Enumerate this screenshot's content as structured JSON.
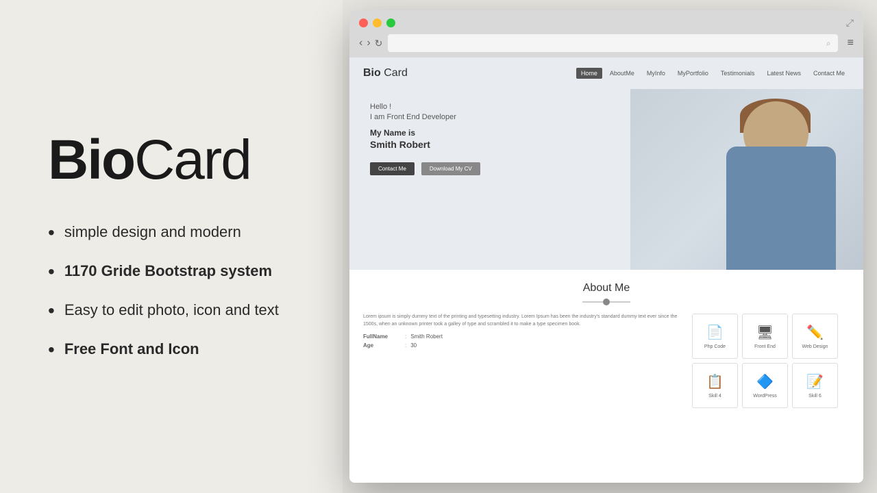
{
  "left": {
    "title_bold": "Bio",
    "title_light": "Card",
    "features": [
      {
        "text": "simple design and modern",
        "bold": false
      },
      {
        "text": "1170 Gride Bootstrap system",
        "bold": true
      },
      {
        "text": "Easy to edit photo, icon and text",
        "bold": false
      },
      {
        "text": "Free Font and Icon",
        "bold": true
      }
    ]
  },
  "browser": {
    "address": ""
  },
  "website": {
    "logo_bold": "Bio",
    "logo_light": "Card",
    "nav_items": [
      "Home",
      "AboutMe",
      "MyInfo",
      "MyPortfolio",
      "Testimonials",
      "Latest News",
      "Contact Me"
    ],
    "nav_active": "Home",
    "hero_hello": "Hello !",
    "hero_role": "I am Front End Developer",
    "hero_name_intro": "My Name is",
    "hero_name": "Smith Robert",
    "btn_contact": "Contact Me",
    "btn_download": "Download My CV",
    "about_title": "About Me",
    "about_paragraph1": "Lorem ipsum is simply dummy text of the printing and typesetting industry. Lorem Ipsum has been the industry's standard dummy text ever since the 1500s, when an unknown printer took a galley of type and scrambled it to make a type specimen book.",
    "info_rows": [
      {
        "label": "FullName",
        "value": "Smith Robert"
      },
      {
        "label": "Age",
        "value": "30"
      }
    ],
    "skills": [
      {
        "icon": "📄",
        "label": "Php Code"
      },
      {
        "icon": "🖥",
        "label": "Front End"
      },
      {
        "icon": "✏️",
        "label": "Web Design"
      },
      {
        "icon": "📋",
        "label": "Skill 4"
      },
      {
        "icon": "🔷",
        "label": "WordPress"
      },
      {
        "icon": "📝",
        "label": "Skill 6"
      }
    ]
  }
}
